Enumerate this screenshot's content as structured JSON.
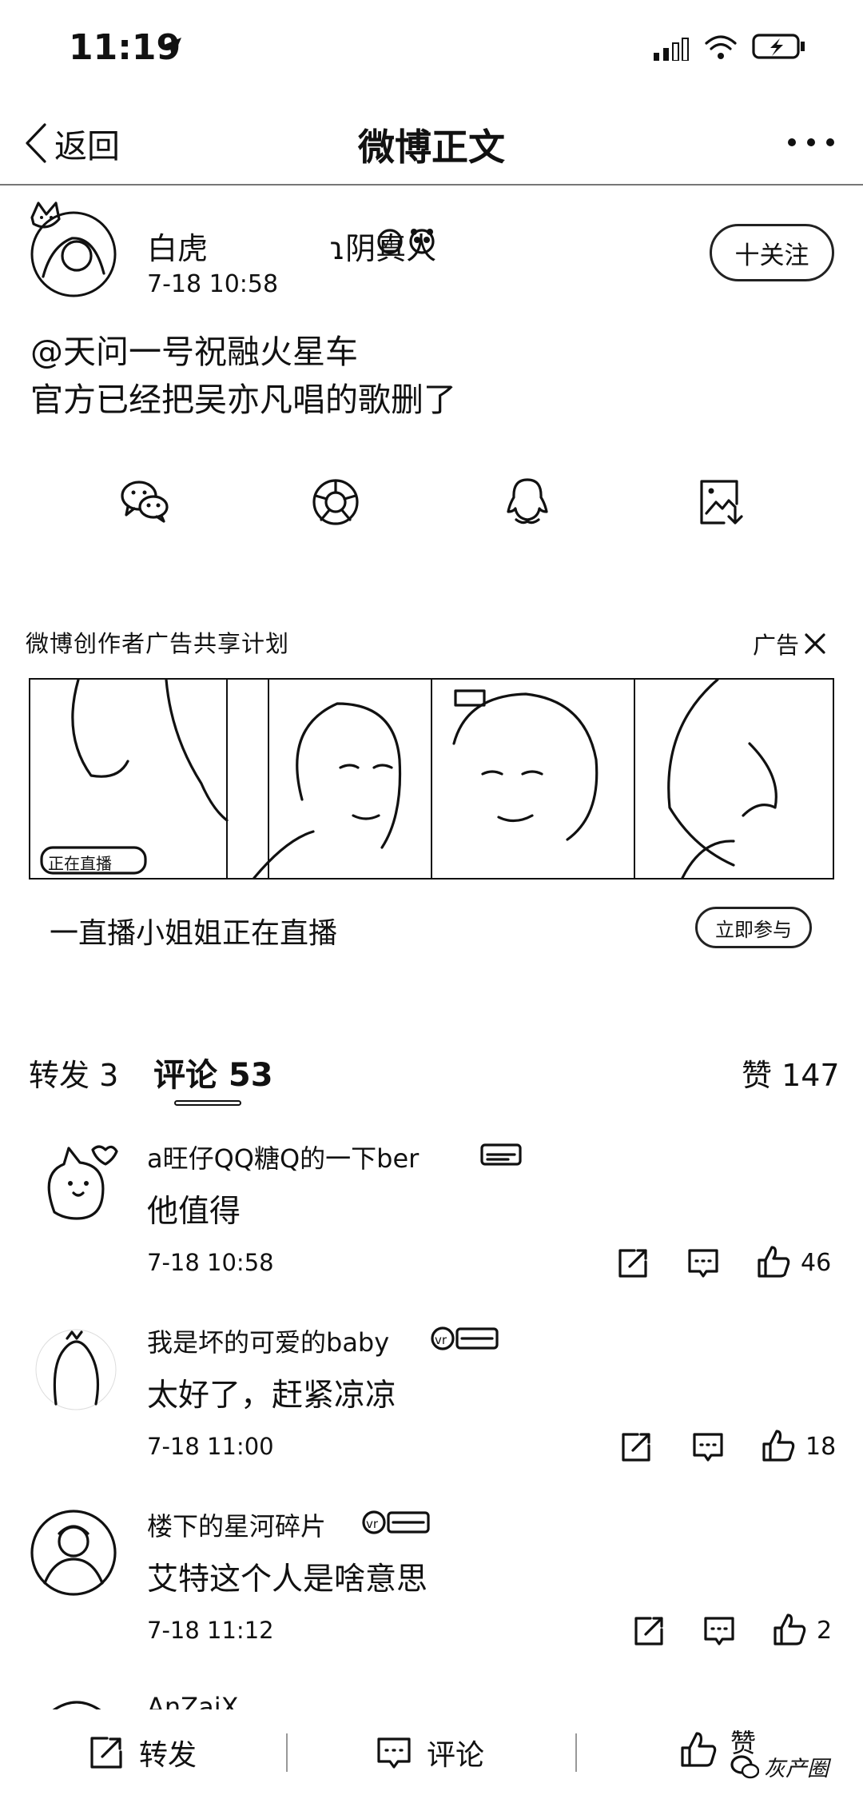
{
  "status_bar": {
    "time": "11:19"
  },
  "nav": {
    "back_label": "返回",
    "title": "微博正文"
  },
  "post": {
    "author_name": "白虎　　　　ɿ阴真人",
    "time": "7-18 10:58",
    "follow_label": "十关注",
    "text_line1": "@天问一号祝融火星车",
    "text_line2": "官方已经把吴亦凡唱的歌删了"
  },
  "share_icons": [
    "wechat-icon",
    "moments-icon",
    "qq-icon",
    "save-image-icon"
  ],
  "ad": {
    "title": "微博创作者广告共享计划",
    "ad_label": "广告",
    "caption": "一直播小姐姐正在直播",
    "badge_text": "正在直播",
    "action_label": "立即参与"
  },
  "tabs": {
    "repost": "转发 3",
    "comment": "评论 53",
    "like": "赞 147"
  },
  "comments": [
    {
      "name": "a旺仔QQ糖Q的一下ber",
      "text": "他值得",
      "time": "7-18 10:58",
      "likes": "46"
    },
    {
      "name": "我是坏的可爱的baby",
      "text": "太好了，赶紧凉凉",
      "time": "7-18 11:00",
      "likes": "18"
    },
    {
      "name": "楼下的星河碎片",
      "text": "艾特这个人是啥意思",
      "time": "7-18 11:12",
      "likes": "2"
    },
    {
      "name": "AnZaiX"
    }
  ],
  "bottom_bar": {
    "repost": "转发",
    "comment": "评论",
    "like": "赞",
    "watermark": "灰产圈"
  }
}
